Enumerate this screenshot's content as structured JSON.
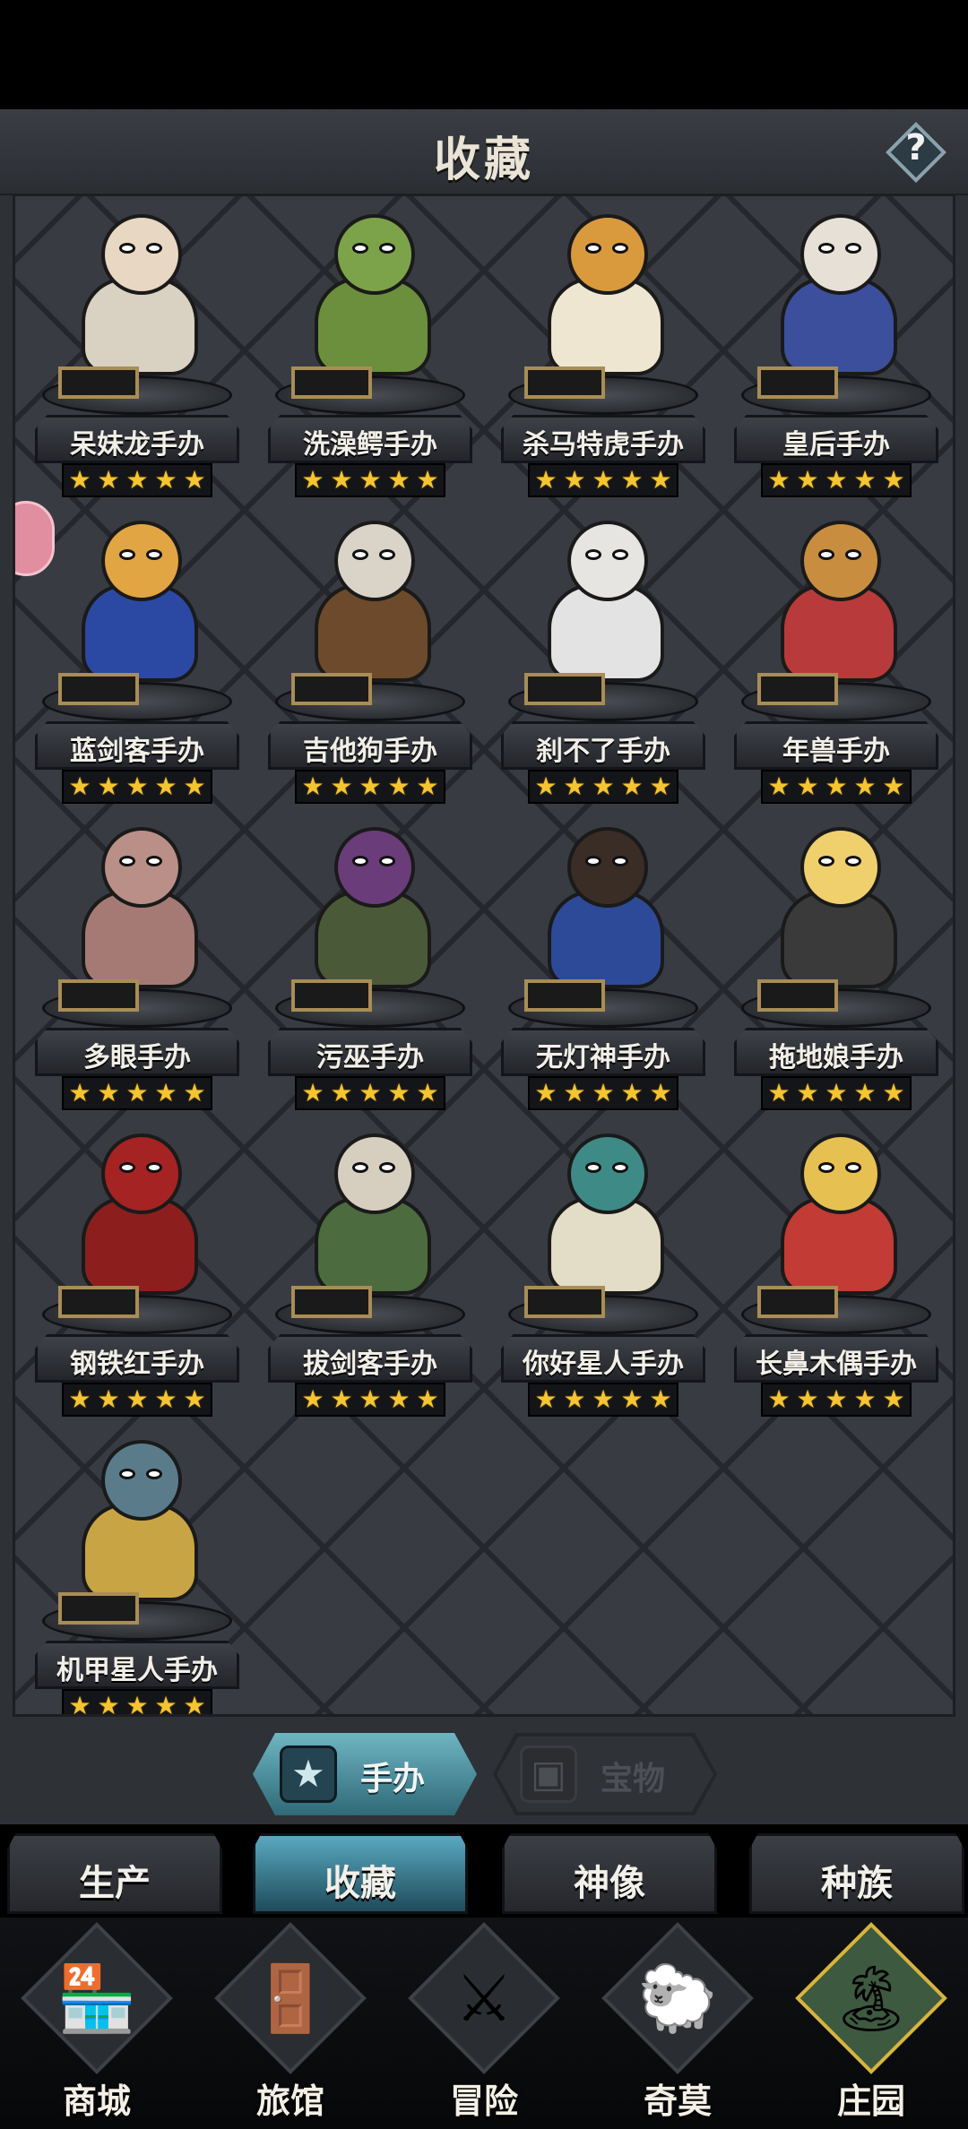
{
  "header": {
    "title": "收藏",
    "help_label": "?"
  },
  "figures": [
    {
      "name": "呆妹龙手办",
      "stars": 5,
      "head": "#e8d7c2",
      "body": "#d9d1c2"
    },
    {
      "name": "洗澡鳄手办",
      "stars": 5,
      "head": "#7da34a",
      "body": "#6b8f3c"
    },
    {
      "name": "杀马特虎手办",
      "stars": 5,
      "head": "#d99a3e",
      "body": "#efe6d2"
    },
    {
      "name": "皇后手办",
      "stars": 5,
      "head": "#e6e0d6",
      "body": "#3b4f9c"
    },
    {
      "name": "蓝剑客手办",
      "stars": 5,
      "head": "#e2a543",
      "body": "#2b49a3"
    },
    {
      "name": "吉他狗手办",
      "stars": 5,
      "head": "#d9d3c8",
      "body": "#6c4a2b"
    },
    {
      "name": "刹不了手办",
      "stars": 5,
      "head": "#e7e5e1",
      "body": "#e3e3e3"
    },
    {
      "name": "年兽手办",
      "stars": 5,
      "head": "#c98d40",
      "body": "#b93a3a"
    },
    {
      "name": "多眼手办",
      "stars": 5,
      "head": "#b98f87",
      "body": "#a57a74"
    },
    {
      "name": "污巫手办",
      "stars": 5,
      "head": "#6a3c7a",
      "body": "#4a5a38"
    },
    {
      "name": "无灯神手办",
      "stars": 5,
      "head": "#3a2d26",
      "body": "#2d4a98"
    },
    {
      "name": "拖地娘手办",
      "stars": 5,
      "head": "#f0cf6d",
      "body": "#3a3a3a"
    },
    {
      "name": "钢铁红手办",
      "stars": 5,
      "head": "#a52323",
      "body": "#8d1e1e"
    },
    {
      "name": "拔剑客手办",
      "stars": 5,
      "head": "#d6cfc0",
      "body": "#4c6b3f"
    },
    {
      "name": "你好星人手办",
      "stars": 5,
      "head": "#3e8a86",
      "body": "#e3dcc6"
    },
    {
      "name": "长鼻木偶手办",
      "stars": 5,
      "head": "#e7c052",
      "body": "#c23b34"
    },
    {
      "name": "机甲星人手办",
      "stars": 5,
      "head": "#5a7b8a",
      "body": "#c9a444"
    }
  ],
  "sub_tabs": {
    "figures": "手办",
    "treasures": "宝物"
  },
  "section_tabs": [
    "生产",
    "收藏",
    "神像",
    "种族"
  ],
  "bottom_nav": [
    {
      "label": "商城",
      "icon": "shop-icon"
    },
    {
      "label": "旅馆",
      "icon": "inn-icon"
    },
    {
      "label": "冒险",
      "icon": "crossed-swords-icon"
    },
    {
      "label": "奇莫",
      "icon": "creature-icon"
    },
    {
      "label": "庄园",
      "icon": "manor-island-icon"
    }
  ]
}
